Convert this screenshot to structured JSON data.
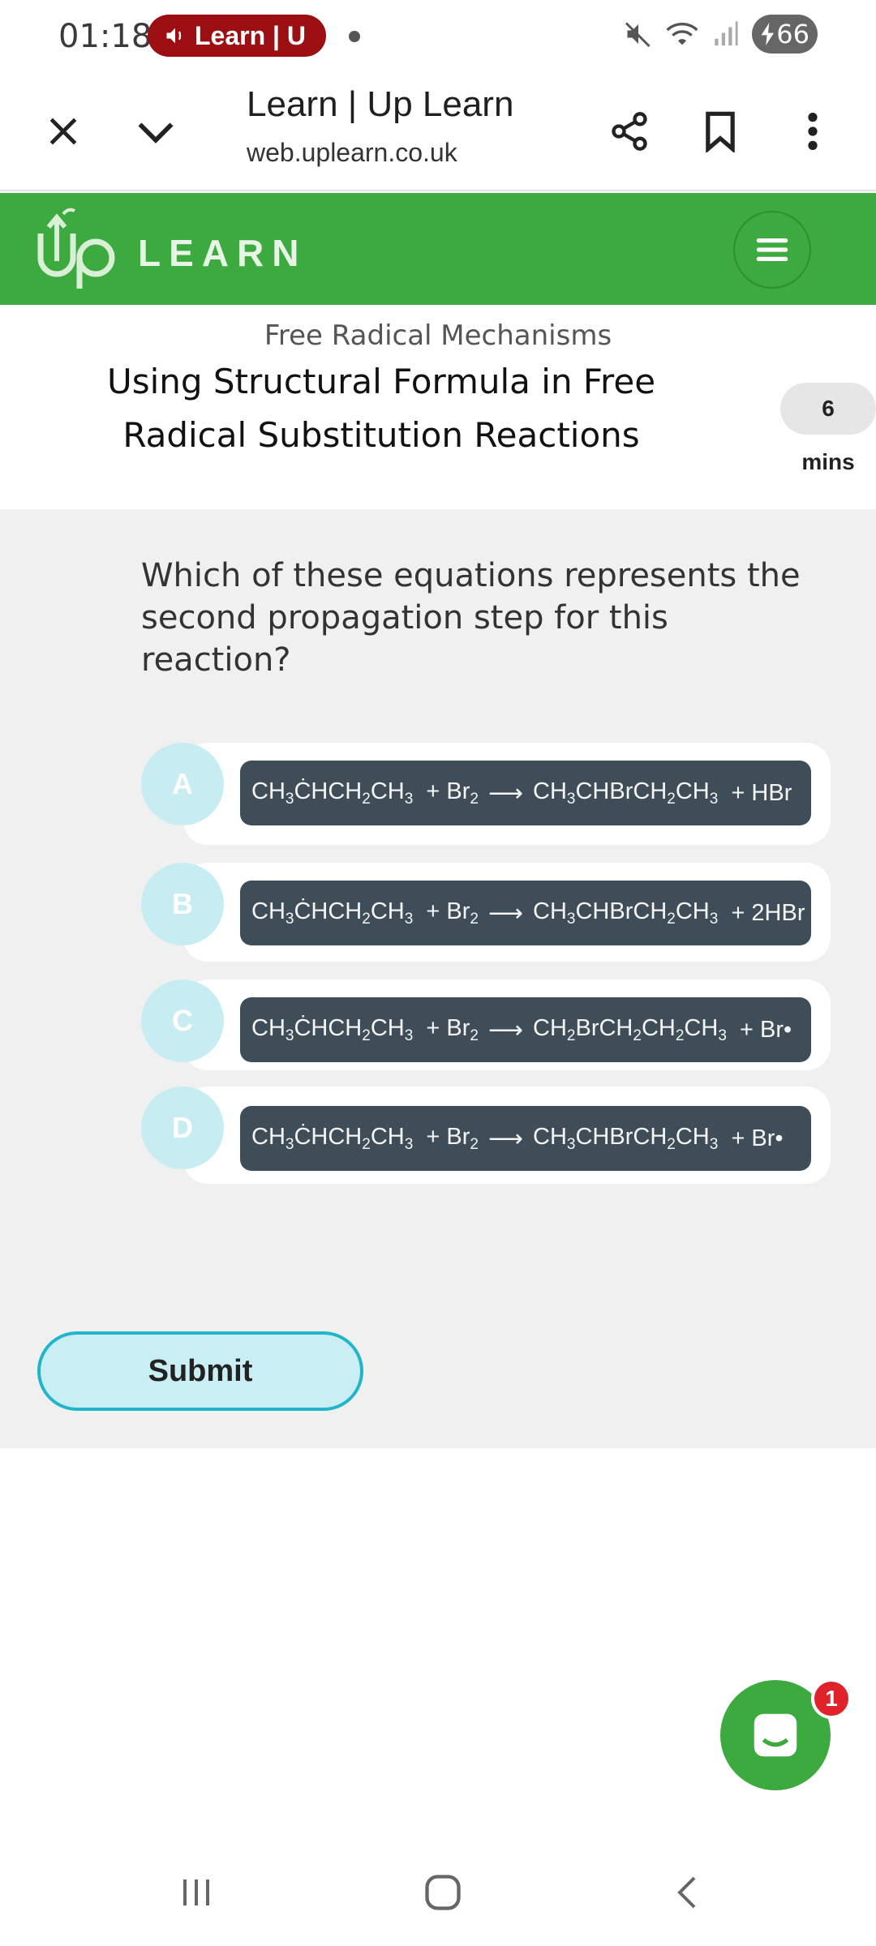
{
  "status_bar": {
    "time": "01:18",
    "media_label": "Learn | U",
    "battery": "66"
  },
  "browser": {
    "title": "Learn | Up Learn",
    "url": "web.uplearn.co.uk"
  },
  "site": {
    "brand": "LEARN",
    "accent_color": "#3daa3f"
  },
  "lesson": {
    "module": "Free Radical Mechanisms",
    "title": "Using Structural Formula in Free Radical Substitution Reactions",
    "duration_value": "6",
    "duration_unit": "mins"
  },
  "question": {
    "text": "Which of these equations represents the second propagation step for this reaction?",
    "options": [
      {
        "letter": "A",
        "reactant": "CH3CHCH2CH3",
        "product": "CH3CHBrCH2CH3",
        "byproduct": "+ HBr"
      },
      {
        "letter": "B",
        "reactant": "CH3CHCH2CH3",
        "product": "CH3CHBrCH2CH3",
        "byproduct": "+ 2HBr"
      },
      {
        "letter": "C",
        "reactant": "CH3CHCH2CH3",
        "product": "CH2BrCH2CH2CH3",
        "byproduct": "+ Br•"
      },
      {
        "letter": "D",
        "reactant": "CH3CHCH2CH3",
        "product": "CH3CHBrCH2CH3",
        "byproduct": "+ Br•"
      }
    ],
    "reagent": "+ Br2",
    "submit_label": "Submit"
  },
  "chat": {
    "badge_count": "1"
  }
}
